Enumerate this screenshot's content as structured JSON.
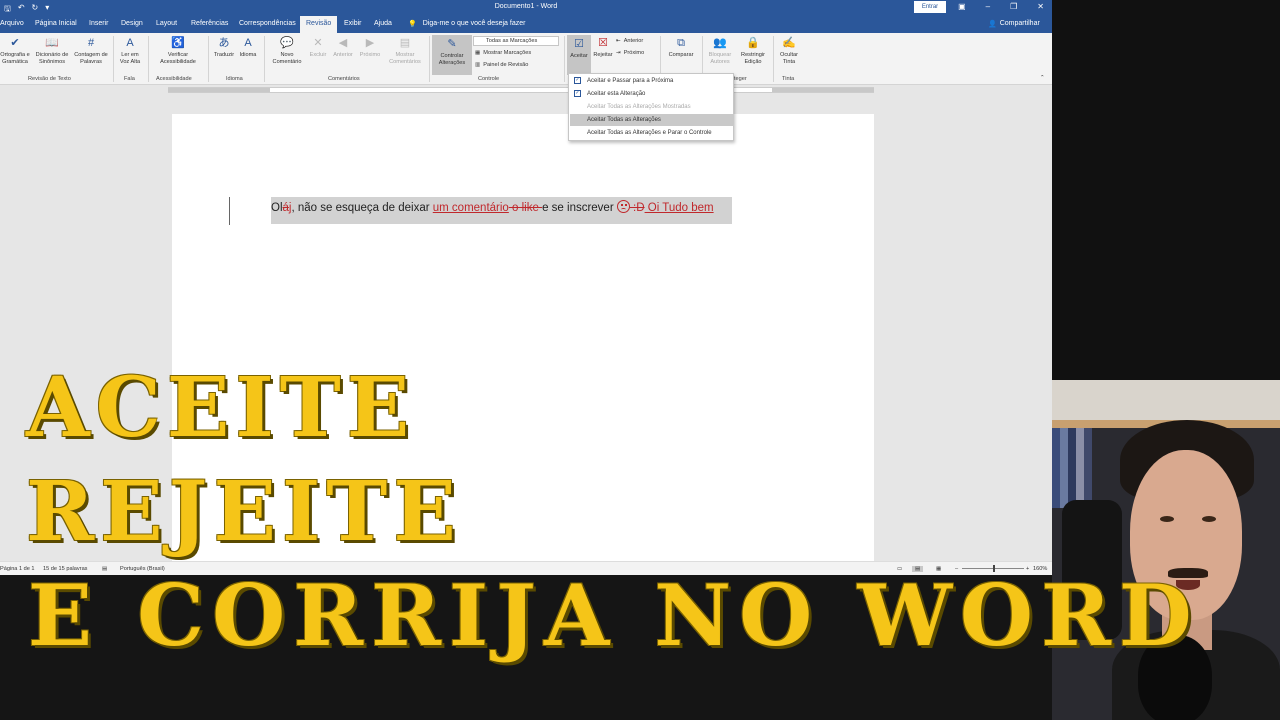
{
  "titlebar": {
    "doc_title": "Documento1 - Word",
    "signin": "Entrar"
  },
  "tabs": {
    "items": [
      "Arquivo",
      "Página Inicial",
      "Inserir",
      "Design",
      "Layout",
      "Referências",
      "Correspondências",
      "Revisão",
      "Exibir",
      "Ajuda"
    ],
    "active": "Revisão",
    "tell_me": "Diga-me o que você deseja fazer",
    "share": "Compartilhar"
  },
  "ribbon": {
    "spelling": "Ortografia e Gramática",
    "thesaurus": "Dicionário de Sinônimos",
    "word_count": "Contagem de Palavras",
    "group_proofing": "Revisão de Texto",
    "read_aloud": "Ler em Voz Alta",
    "group_speech": "Fala",
    "accessibility": "Verificar Acessibilidade",
    "group_accessibility": "Acessibilidade",
    "translate": "Traduzir",
    "language": "Idioma",
    "group_language": "Idioma",
    "new_comment": "Novo Comentário",
    "delete": "Excluir",
    "previous": "Anterior",
    "next": "Próximo",
    "show_comments": "Mostrar Comentários",
    "group_comments": "Comentários",
    "track_changes": "Controlar Alterações",
    "markup_combo": "Todas as Marcações",
    "show_markup": "Mostrar Marcações",
    "review_pane": "Painel de Revisão",
    "group_tracking": "Controle",
    "accept": "Aceitar",
    "reject": "Rejeitar",
    "prev_change": "Anterior",
    "next_change": "Próximo",
    "compare": "Comparar",
    "block_authors": "Bloquear Autores",
    "restrict": "Restringir Edição",
    "group_protect": "teger",
    "hide_ink": "Ocultar Tinta",
    "group_ink": "Tinta"
  },
  "accept_menu": {
    "items": [
      {
        "label": "Aceitar e Passar para a Próxima",
        "state": "normal"
      },
      {
        "label": "Aceitar esta Alteração",
        "state": "normal"
      },
      {
        "label": "Aceitar Todas as Alterações Mostradas",
        "state": "disabled"
      },
      {
        "label": "Aceitar Todas as Alterações",
        "state": "highlighted"
      },
      {
        "label": "Aceitar Todas as Alterações e Parar o Controle",
        "state": "normal"
      }
    ]
  },
  "document": {
    "seg1": "Ol",
    "seg2_deleted": "á",
    "seg3_inserted": "j",
    "seg4": ", não se esqueça de deixar ",
    "seg5_inserted": "um comentário",
    "seg6_deleted": " o like ",
    "seg7": "e se inscrever ",
    "seg8_deleted": " :D",
    "seg9_inserted": " Oi Tudo bem"
  },
  "statusbar": {
    "page": "Página 1 de 1",
    "words": "15 de 15 palavras",
    "language": "Português (Brasil)",
    "zoom": "160%"
  },
  "overlay": {
    "line1": "ACEITE",
    "line2": "REJEITE",
    "line3": "E CORRIJA NO WORD"
  },
  "colors": {
    "word_blue": "#2b579a",
    "track_red": "#c0282c",
    "title_yellow": "#f5c518"
  }
}
